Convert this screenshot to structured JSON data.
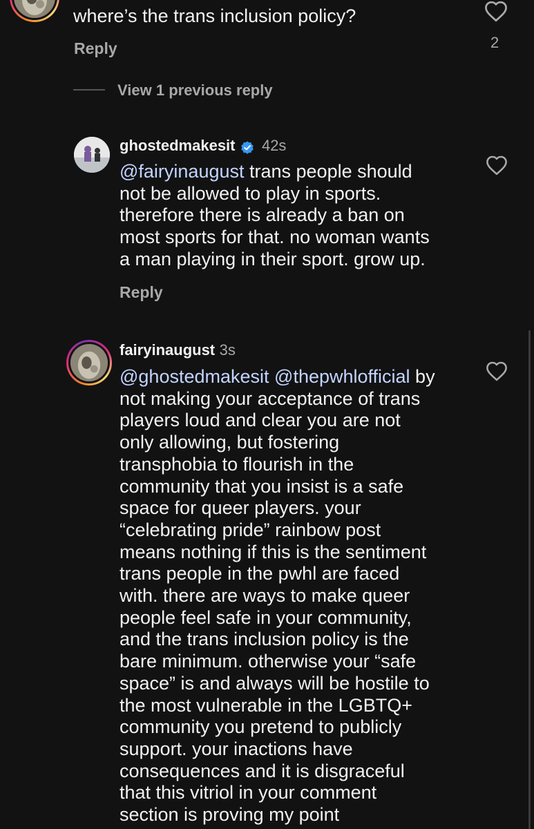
{
  "comment1": {
    "text": "where’s the trans inclusion policy?",
    "reply_label": "Reply",
    "like_count": "2",
    "avatar_icon": "profile-photo-icon",
    "heart_icon": "heart-outline-icon"
  },
  "thread": {
    "view_replies_label": "View 1 previous reply"
  },
  "comment2": {
    "username": "ghostedmakesit",
    "time": "42s",
    "verified_icon": "verified-badge-icon",
    "lines": [
      {
        "mention": "@fairyinaugust",
        "text": " trans people should"
      },
      {
        "mention": "",
        "text": "not be allowed to play in sports."
      },
      {
        "mention": "",
        "text": "therefore there is already a ban on"
      },
      {
        "mention": "",
        "text": "most sports for that. no woman wants"
      },
      {
        "mention": "",
        "text": "a man playing in their sport. grow up."
      }
    ],
    "reply_label": "Reply",
    "heart_icon": "heart-outline-icon"
  },
  "comment3": {
    "username": "fairyinaugust",
    "time": "3s",
    "first_line": {
      "mention1": "@ghostedmakesit",
      "mention2": "@thepwhlofficial",
      "text": " by"
    },
    "lines": [
      "not making your acceptance of trans",
      "players loud and clear you are not",
      "only allowing, but fostering",
      "transphobia to flourish in the",
      "community that you insist is a safe",
      "space for queer players. your",
      "“celebrating pride” rainbow post",
      "means nothing if this is the sentiment",
      "trans people in the pwhl are faced",
      "with. there are ways to make queer",
      "people feel safe in your community,",
      "and the trans inclusion policy is the",
      "bare minimum. otherwise your “safe",
      "space” is and always will be hostile to",
      "the most vulnerable in the LGBTQ+",
      "community you pretend to publicly",
      "support. your inactions have",
      "consequences and it is disgraceful",
      "that this vitriol in your comment",
      "section is proving my point"
    ],
    "heart_icon": "heart-outline-icon"
  },
  "colors": {
    "background": "#121212",
    "text": "#f2f2f2",
    "secondary": "#a8a8a8",
    "mention": "#c2d4ff",
    "verified": "#3897f0"
  }
}
